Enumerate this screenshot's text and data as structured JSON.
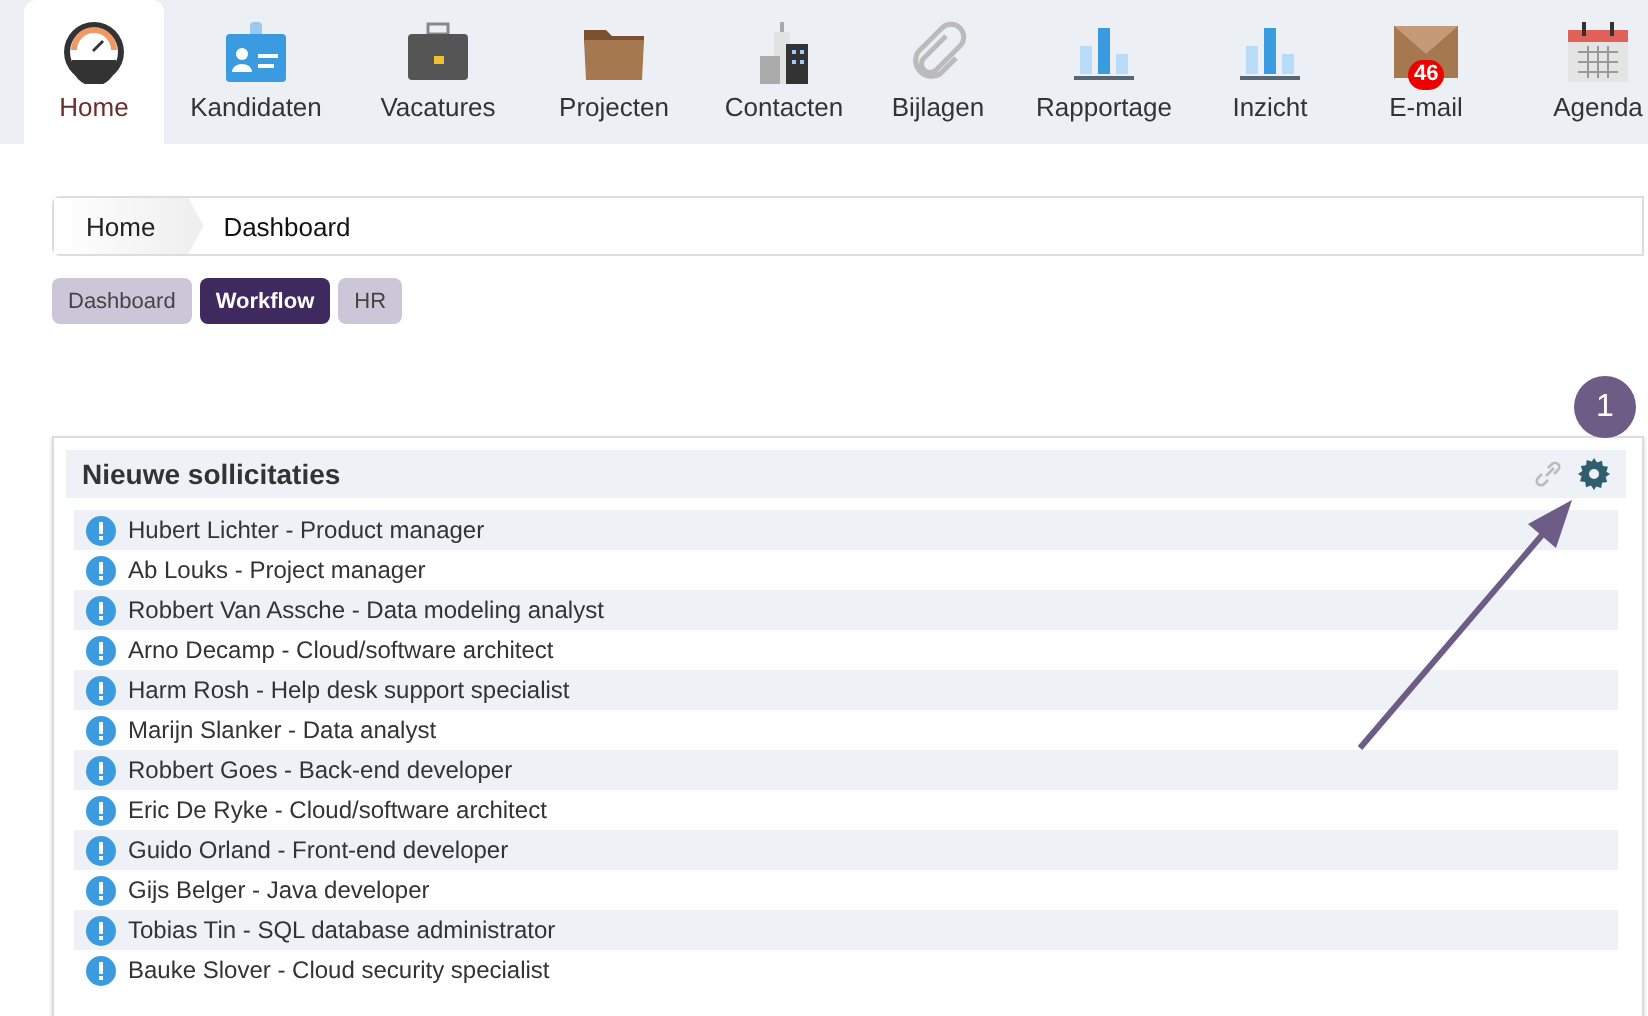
{
  "nav": [
    {
      "label": "Home",
      "selected": true
    },
    {
      "label": "Kandidaten",
      "selected": false
    },
    {
      "label": "Vacatures",
      "selected": false
    },
    {
      "label": "Projecten",
      "selected": false
    },
    {
      "label": "Contacten",
      "selected": false
    },
    {
      "label": "Bijlagen",
      "selected": false
    },
    {
      "label": "Rapportage",
      "selected": false
    },
    {
      "label": "Inzicht",
      "selected": false
    },
    {
      "label": "E-mail",
      "selected": false,
      "badge": "46"
    },
    {
      "label": "Agenda",
      "selected": false
    }
  ],
  "breadcrumb": [
    "Home",
    "Dashboard"
  ],
  "tabs": [
    {
      "label": "Dashboard",
      "selected": false
    },
    {
      "label": "Workflow",
      "selected": true
    },
    {
      "label": "HR",
      "selected": false
    }
  ],
  "callout": "1",
  "panel": {
    "title": "Nieuwe sollicitaties",
    "items": [
      "Hubert Lichter - Product manager",
      "Ab Louks - Project manager",
      "Robbert Van Assche - Data modeling analyst",
      "Arno Decamp - Cloud/software architect",
      "Harm Rosh - Help desk support specialist",
      "Marijn Slanker - Data analyst",
      "Robbert Goes - Back-end developer",
      "Eric De Ryke - Cloud/software architect",
      "Guido Orland - Front-end developer",
      "Gijs Belger - Java developer",
      "Tobias Tin - SQL database administrator",
      "Bauke Slover - Cloud security specialist"
    ]
  }
}
